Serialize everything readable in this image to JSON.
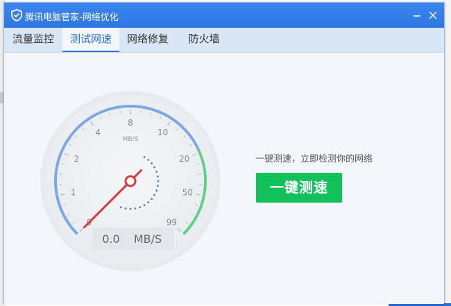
{
  "window": {
    "title": "腾讯电脑管家-网络优化"
  },
  "tabs": [
    {
      "label": "流量监控"
    },
    {
      "label": "测试网速"
    },
    {
      "label": "网络修复"
    },
    {
      "label": "防火墙"
    }
  ],
  "gauge": {
    "unit": "MB/S",
    "readout_value": "0.0",
    "readout_unit": "MB/S",
    "scale_labels": [
      "0",
      "1",
      "2",
      "4",
      "8",
      "10",
      "20",
      "50",
      "99"
    ],
    "needle_value": 0,
    "colors": {
      "arc_blue": "#7ea7e6",
      "arc_green": "#5fd08a",
      "needle": "#d83a3a",
      "dots": "#3b82e8"
    }
  },
  "test": {
    "hint": "一键测速，立即检测你的网络",
    "button_label": "一键测速"
  }
}
